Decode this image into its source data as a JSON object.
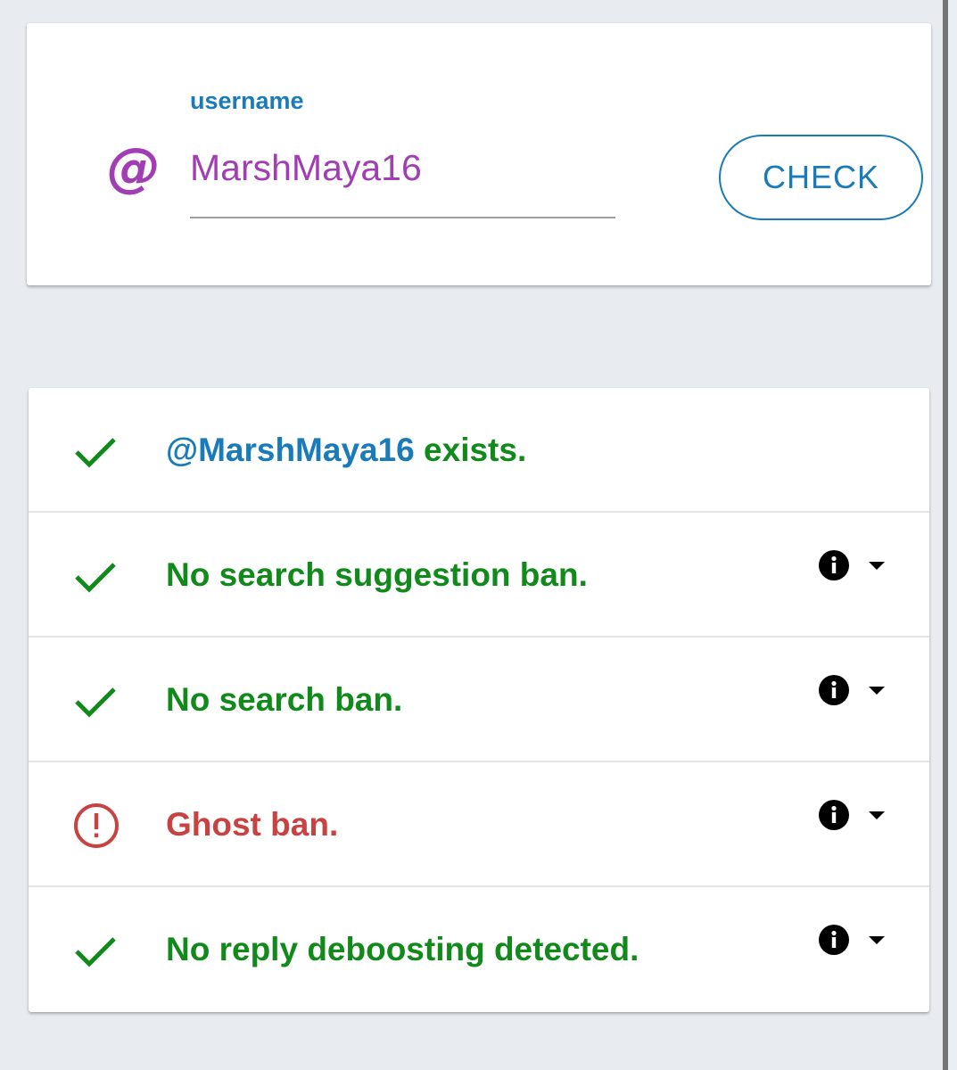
{
  "colors": {
    "accent_blue": "#1a7bb9",
    "username_purple": "#a23eb3",
    "success_green": "#118a1b",
    "error_red": "#c94242",
    "info_black": "#000000"
  },
  "search": {
    "label": "username",
    "at_symbol": "@",
    "value": "MarshMaya16",
    "button_label": "CHECK"
  },
  "results": {
    "exists": {
      "handle": "@MarshMaya16",
      "text": " exists.",
      "status": "ok",
      "icon": "check-icon"
    },
    "items": [
      {
        "text": "No search suggestion ban.",
        "status": "ok",
        "icon": "check-icon"
      },
      {
        "text": "No search ban.",
        "status": "ok",
        "icon": "check-icon"
      },
      {
        "text": "Ghost ban.",
        "status": "error",
        "icon": "alert-circle-icon"
      },
      {
        "text": "No reply deboosting detected.",
        "status": "ok",
        "icon": "check-icon"
      }
    ],
    "info_icon": "info-icon",
    "dropdown_icon": "caret-down-icon"
  }
}
